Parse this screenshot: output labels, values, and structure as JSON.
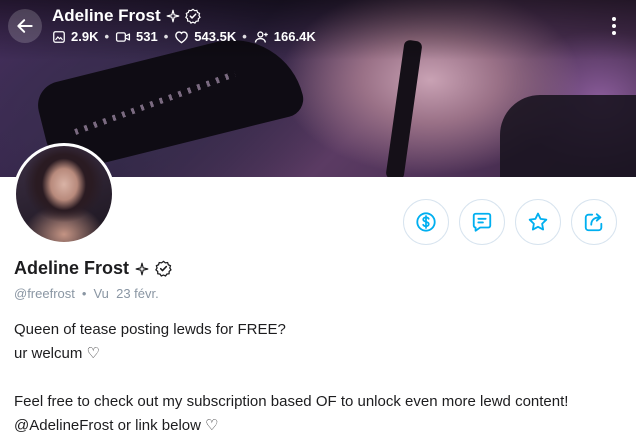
{
  "header": {
    "name": "Adeline Frost",
    "stats": [
      {
        "icon": "image-icon",
        "value": "2.9K"
      },
      {
        "icon": "video-icon",
        "value": "531"
      },
      {
        "icon": "heart-icon",
        "value": "543.5K"
      },
      {
        "icon": "fans-icon",
        "value": "166.4K"
      }
    ]
  },
  "profile": {
    "name": "Adeline Frost",
    "handle": "@freefrost",
    "separator": "•",
    "last_seen": "Vu  23 févr."
  },
  "bio": {
    "line1": "Queen of tease posting lewds for FREE?",
    "line2": "ur welcum ♡",
    "line3": "Feel free to check out my subscription based OF to unlock even more lewd content!",
    "line4": "@AdelineFrost or link below ♡"
  },
  "actions": [
    "tip-button",
    "message-button",
    "favorite-button",
    "share-button"
  ],
  "colors": {
    "accent": "#00aff0",
    "muted": "#8a96a3",
    "text": "#1d1d1f"
  }
}
